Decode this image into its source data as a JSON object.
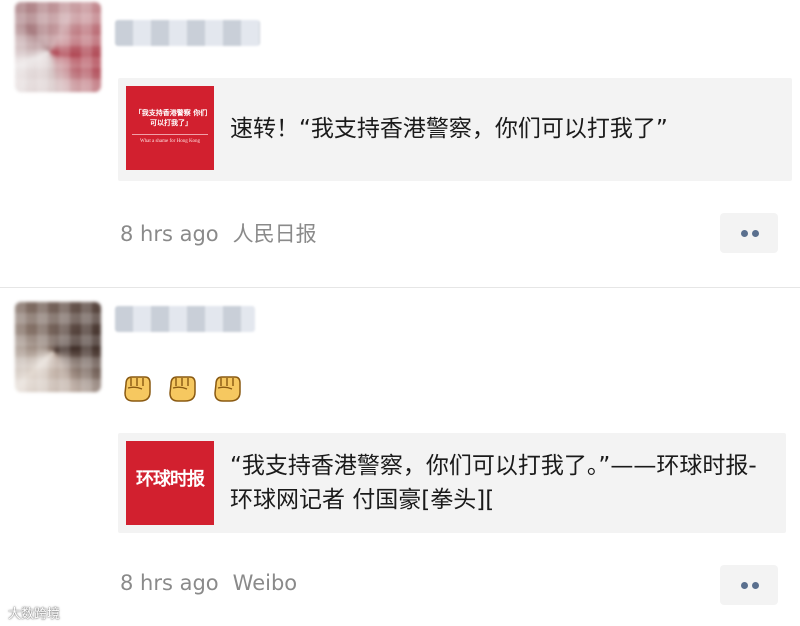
{
  "posts": [
    {
      "card_text": "速转！“我支持香港警察，你们可以打我了”",
      "thumb": {
        "quote": "「我支持香港警察 你们可以打我了」",
        "subtitle": "What a shame for Hong Kong"
      },
      "time": "8 hrs ago",
      "source": "人民日报"
    },
    {
      "emojis": [
        "fist-emoji",
        "fist-emoji",
        "fist-emoji"
      ],
      "card_text": "“我支持香港警察，你们可以打我了。”——环球时报-环球网记者 付国豪[拳头][",
      "thumb": {
        "logo": "环球时报"
      },
      "time": "8 hrs ago",
      "source": "Weibo"
    }
  ],
  "watermark": "大数跨境",
  "colors": {
    "accent": "#d2202f",
    "meta": "#8a8a8a",
    "dots": "#5a6f8e",
    "card_bg": "#f3f3f3"
  }
}
